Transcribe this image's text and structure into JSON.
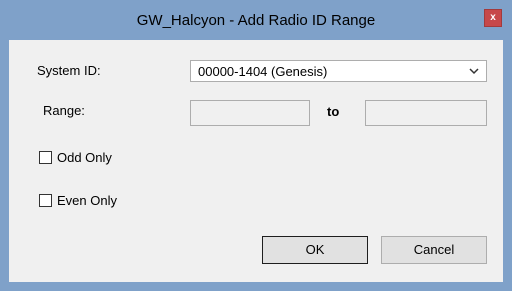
{
  "window": {
    "title": "GW_Halcyon - Add Radio ID Range",
    "close_glyph": "x"
  },
  "form": {
    "system_id_label": "System ID:",
    "system_id_value": "00000-1404 (Genesis)",
    "range_label": "Range:",
    "range_from_value": "",
    "range_to_label": "to",
    "range_to_value": "",
    "odd_only_label": "Odd Only",
    "odd_only_checked": false,
    "even_only_label": "Even Only",
    "even_only_checked": false
  },
  "buttons": {
    "ok_label": "OK",
    "cancel_label": "Cancel"
  },
  "colors": {
    "title_bar": "#7fa1c9",
    "close_button": "#c7484a",
    "dialog_body": "#f0f0f0"
  },
  "icons": {
    "close": "close-icon",
    "dropdown": "chevron-down-icon"
  }
}
